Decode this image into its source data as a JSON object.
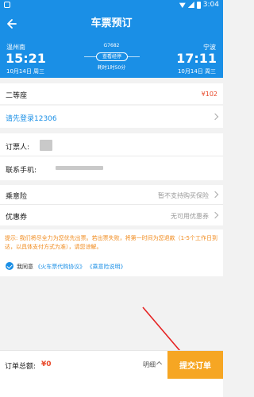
{
  "status_bar": {
    "time": "3:04"
  },
  "header": {
    "title": "车票预订"
  },
  "train": {
    "from_station": "温州南",
    "from_time": "15:21",
    "from_date": "10月14日 周三",
    "to_station": "宁波",
    "to_time": "17:11",
    "to_date": "10月14日 周三",
    "train_no": "G7682",
    "stops_label": "查看经停",
    "duration": "耗时1时50分"
  },
  "seat": {
    "label": "二等座",
    "price": "¥102"
  },
  "login": {
    "label": "请先登录12306"
  },
  "passenger": {
    "label": "订票人:"
  },
  "phone": {
    "label": "联系手机:"
  },
  "insurance": {
    "label": "乘意险",
    "value": "暂不支持购买保险"
  },
  "coupon": {
    "label": "优惠券",
    "value": "无可用优惠券"
  },
  "notice": {
    "text": "提示: 我们将尽全力为您优先出票。若出票失败，将第一时间为您退款（1-5个工作日到达，以具体支付方式为准），请您谅解。"
  },
  "agreement": {
    "prefix": "我同意",
    "link1": "《火车票代购协议》",
    "link2": "《乘意险说明》"
  },
  "footer": {
    "total_label": "订单总额:",
    "total_value": "¥0",
    "detail_label": "明细",
    "submit_label": "提交订单"
  },
  "colors": {
    "primary": "#1a8fe6",
    "accent": "#f6a623",
    "price": "#e84a2b",
    "notice": "#f08a1c"
  }
}
